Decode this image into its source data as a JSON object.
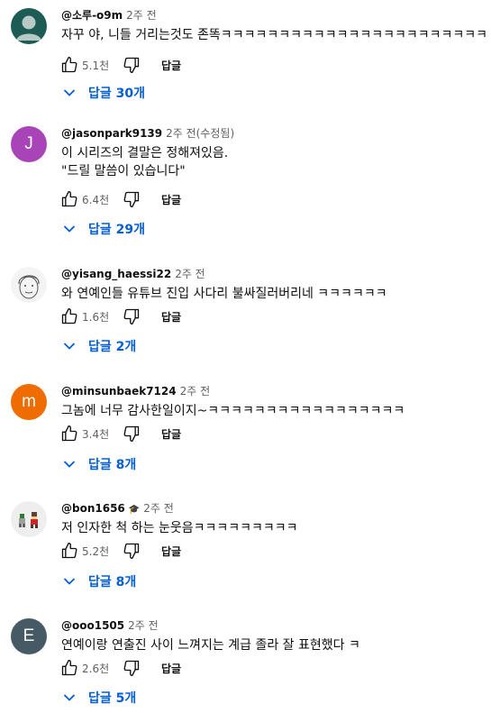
{
  "comments": [
    {
      "handle": "@소루-o9m",
      "time": "2주 전",
      "edited": "",
      "lines": [
        "자꾸 야, 니들 거리는것도 존똑ㅋㅋㅋㅋㅋㅋㅋㅋㅋㅋㅋㅋㅋㅋㅋㅋㅋㅋㅋㅋㅋㅋㅋ"
      ],
      "likes": "5.1천",
      "reply_label": "답글",
      "replies_label": "답글 30개",
      "avatar": {
        "type": "default-user",
        "bg": "#1d5c55"
      }
    },
    {
      "handle": "@jasonpark9139",
      "time": "2주 전",
      "edited": "(수정됨)",
      "lines": [
        "이 시리즈의 결말은 정해져있음.",
        "\"드릴 말씀이 있습니다\""
      ],
      "likes": "6.4천",
      "reply_label": "답글",
      "replies_label": "답글 29개",
      "avatar": {
        "type": "letter",
        "letter": "J",
        "bg": "#a844b8"
      }
    },
    {
      "handle": "@yisang_haessi22",
      "time": "2주 전",
      "edited": "",
      "lines": [
        "와 연예인들 유튜브 진입 사다리 불싸질러버리네 ㅋㅋㅋㅋㅋㅋ"
      ],
      "likes": "1.6천",
      "reply_label": "답글",
      "replies_label": "답글 2개",
      "avatar": {
        "type": "sketch-face",
        "bg": "#f4f4f4"
      }
    },
    {
      "handle": "@minsunbaek7124",
      "time": "2주 전",
      "edited": "",
      "lines": [
        "그놈에 너무 감사한일이지~ㅋㅋㅋㅋㅋㅋㅋㅋㅋㅋㅋㅋㅋㅋㅋㅋㅋ"
      ],
      "likes": "3.4천",
      "reply_label": "답글",
      "replies_label": "답글 8개",
      "avatar": {
        "type": "letter",
        "letter": "m",
        "bg": "#ef6c00"
      }
    },
    {
      "handle": "@bon1656",
      "time": "2주 전",
      "edited": "",
      "lines": [
        "저 인자한 척 하는 눈웃음ㅋㅋㅋㅋㅋㅋㅋㅋㅋ"
      ],
      "likes": "5.2천",
      "reply_label": "답글",
      "replies_label": "답글 8개",
      "avatar": {
        "type": "pixel-figures",
        "bg": "#eeeeee"
      }
    },
    {
      "handle": "@ooo1505",
      "time": "2주 전",
      "edited": "",
      "lines": [
        "연예이랑 연출진 사이 느껴지는 계급 졸라 잘 표현했다 ㅋ"
      ],
      "likes": "2.6천",
      "reply_label": "답글",
      "replies_label": "답글 5개",
      "avatar": {
        "type": "letter",
        "letter": "E",
        "bg": "#455a64"
      }
    }
  ]
}
